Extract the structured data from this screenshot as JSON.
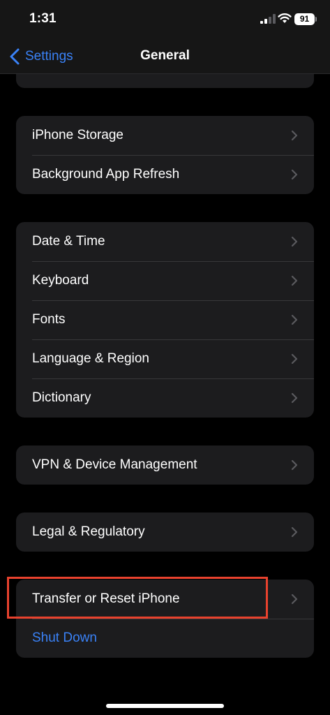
{
  "status_bar": {
    "time": "1:31",
    "battery_level": "91",
    "icons": [
      "cellular-signal-icon",
      "wifi-icon",
      "battery-icon"
    ]
  },
  "nav": {
    "back_label": "Settings",
    "title": "General"
  },
  "groups": [
    {
      "items": [
        {
          "label": "iPhone Storage"
        },
        {
          "label": "Background App Refresh"
        }
      ]
    },
    {
      "items": [
        {
          "label": "Date & Time"
        },
        {
          "label": "Keyboard"
        },
        {
          "label": "Fonts"
        },
        {
          "label": "Language & Region"
        },
        {
          "label": "Dictionary"
        }
      ]
    },
    {
      "items": [
        {
          "label": "VPN & Device Management"
        }
      ]
    },
    {
      "items": [
        {
          "label": "Legal & Regulatory"
        }
      ]
    },
    {
      "items": [
        {
          "label": "Transfer or Reset iPhone"
        },
        {
          "label": "Shut Down"
        }
      ]
    }
  ],
  "colors": {
    "background": "#000000",
    "cell": "#1c1c1e",
    "accent_blue": "#3a82f7",
    "highlight_red": "#e8422e"
  }
}
